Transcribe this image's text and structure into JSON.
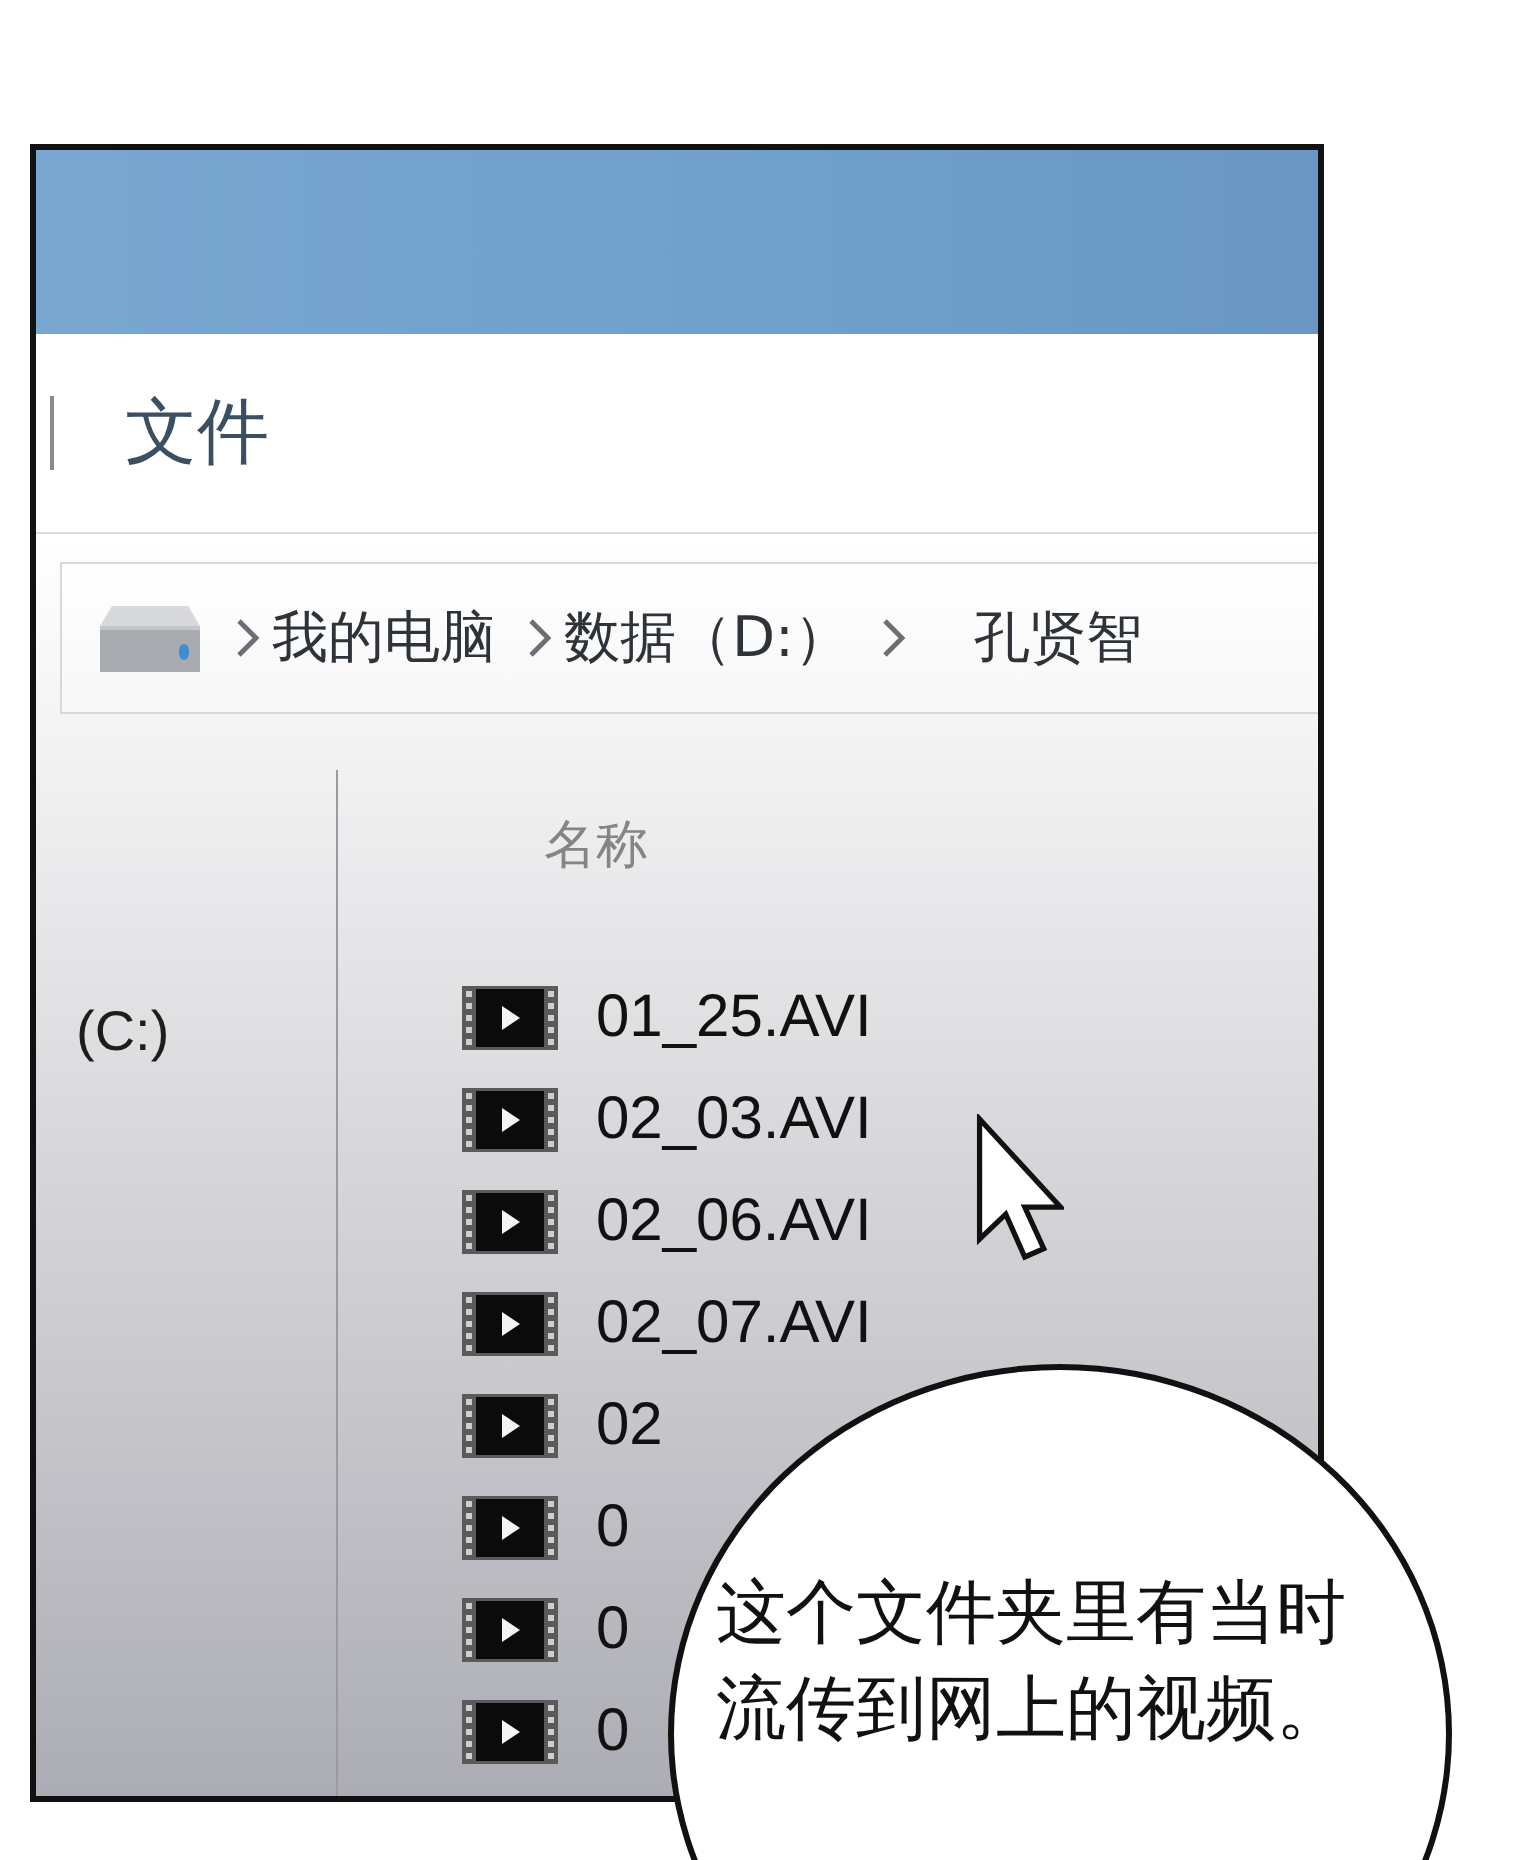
{
  "window": {
    "ribbon_tab": "文件"
  },
  "address_bar": {
    "path": [
      "我的电脑",
      "数据（D:）",
      "孔贤智"
    ]
  },
  "sidebar": {
    "items": [
      {
        "label": "(C:)"
      }
    ]
  },
  "file_list": {
    "column_header": "名称",
    "files": [
      {
        "name": "01_25.AVI"
      },
      {
        "name": "02_03.AVI"
      },
      {
        "name": "02_06.AVI"
      },
      {
        "name": "02_07.AVI"
      },
      {
        "name": "02"
      },
      {
        "name": "0"
      },
      {
        "name": "0"
      },
      {
        "name": "0"
      }
    ]
  },
  "speech_bubble": {
    "text": "这个文件夹里有当时流传到网上的视频。"
  }
}
